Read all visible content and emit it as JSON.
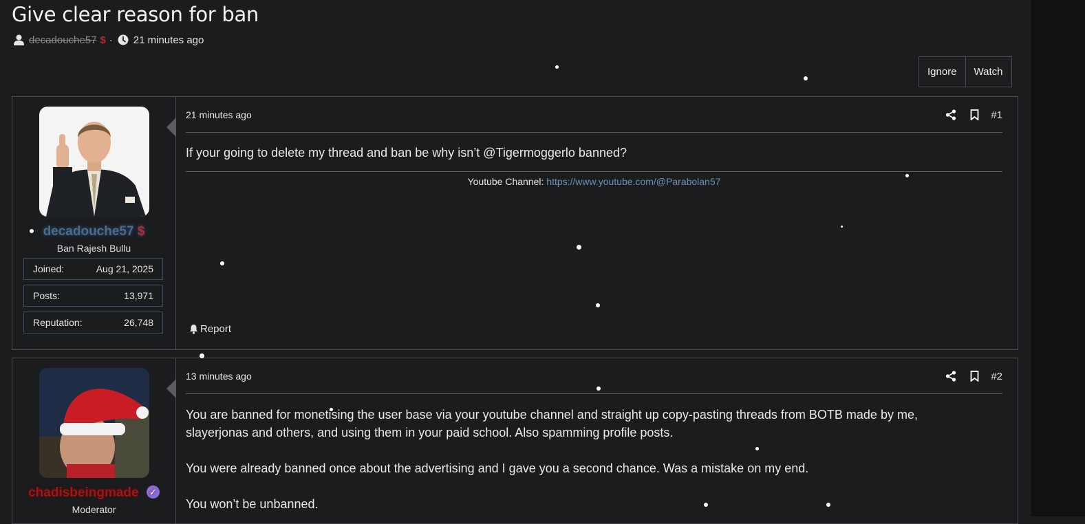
{
  "thread": {
    "title": "Give clear reason for ban",
    "author": "decadouche57",
    "author_badge": "$",
    "separator": "·",
    "time": "21 minutes ago",
    "actions": {
      "ignore": "Ignore",
      "watch": "Watch"
    }
  },
  "posts": [
    {
      "username": "decadouche57",
      "username_badge": "$",
      "user_title": "Ban Rajesh Bullu",
      "stats": [
        {
          "label": "Joined:",
          "value": "Aug 21, 2025"
        },
        {
          "label": "Posts:",
          "value": "13,971"
        },
        {
          "label": "Reputation:",
          "value": "26,748"
        }
      ],
      "time": "21 minutes ago",
      "number": "#1",
      "content": "If your going to delete my thread and ban be why isn’t @Tigermoggerlo banned?",
      "signature_label": "Youtube Channel:",
      "signature_link": "https://www.youtube.com/@Parabolan57",
      "report": "Report"
    },
    {
      "username": "chadisbeingmade",
      "username_badge": "✓",
      "user_title": "Moderator",
      "time": "13 minutes ago",
      "number": "#2",
      "paragraphs": [
        "You are banned for monetising the user base via your youtube channel and straight up copy-pasting threads from BOTB made by me,",
        "slayerjonas and others, and using them in your paid school. Also spamming profile posts.",
        "You were already banned once about the advertising and I gave you a second chance. Was a mistake on my end.",
        "You won’t be unbanned."
      ]
    }
  ],
  "icons": {
    "user": "user-icon",
    "clock": "clock-icon",
    "share": "share-icon",
    "bookmark": "bookmark-icon",
    "bell": "bell-icon",
    "verified": "verified-badge-icon"
  },
  "colors": {
    "background": "#1b1c1e",
    "border": "#4a4b4f",
    "link": "#6f8fb8",
    "username_1": "#4a6b8c",
    "username_2": "#a01515",
    "dollar_badge": "#b52b2b",
    "verified_badge": "#8c6cd8"
  }
}
